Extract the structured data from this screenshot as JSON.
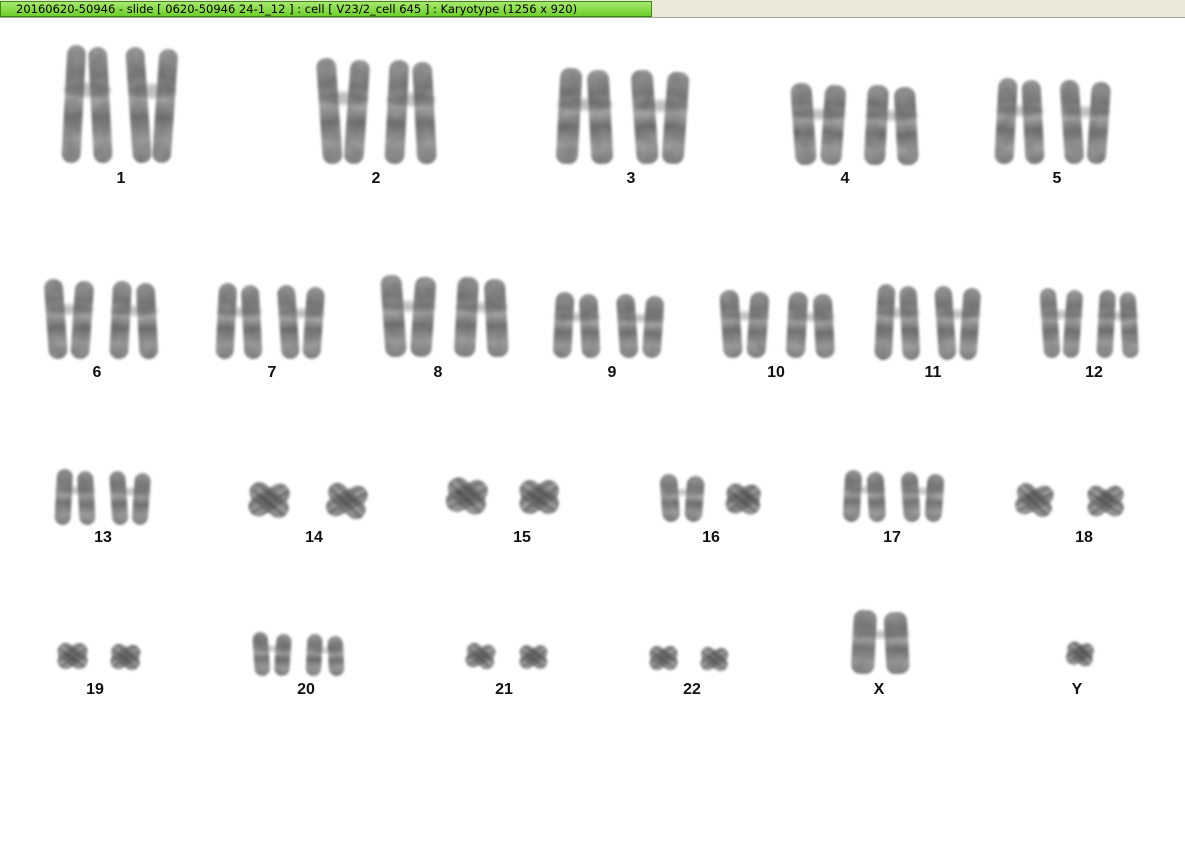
{
  "window": {
    "title": "20160620-50946 - slide [ 0620-50946 24-1_12 ] : cell [ V23/2_cell 645 ] : Karyotype  (1256 x 920)"
  },
  "karyotype": {
    "chromosomes": [
      {
        "label": "1"
      },
      {
        "label": "2"
      },
      {
        "label": "3"
      },
      {
        "label": "4"
      },
      {
        "label": "5"
      },
      {
        "label": "6"
      },
      {
        "label": "7"
      },
      {
        "label": "8"
      },
      {
        "label": "9"
      },
      {
        "label": "10"
      },
      {
        "label": "11"
      },
      {
        "label": "12"
      },
      {
        "label": "13"
      },
      {
        "label": "14"
      },
      {
        "label": "15"
      },
      {
        "label": "16"
      },
      {
        "label": "17"
      },
      {
        "label": "18"
      },
      {
        "label": "19"
      },
      {
        "label": "20"
      },
      {
        "label": "21"
      },
      {
        "label": "22"
      },
      {
        "label": "X"
      },
      {
        "label": "Y"
      }
    ]
  }
}
